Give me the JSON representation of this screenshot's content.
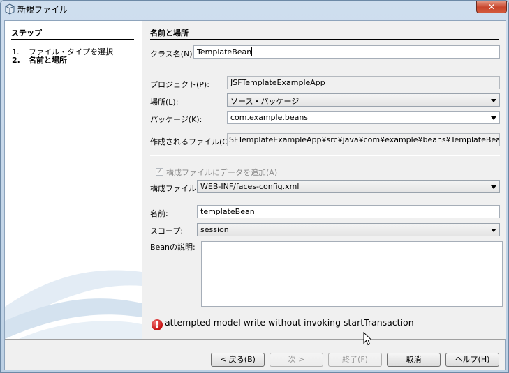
{
  "window": {
    "title": "新規ファイル",
    "close_label": "✕"
  },
  "steps": {
    "title": "ステップ",
    "items": [
      {
        "num": "1.",
        "label": "ファイル・タイプを選択"
      },
      {
        "num": "2.",
        "label": "名前と場所"
      }
    ]
  },
  "main": {
    "section_title": "名前と場所",
    "class_name": {
      "label": "クラス名(N):",
      "value": "TemplateBean"
    },
    "project": {
      "label": "プロジェクト(P):",
      "value": "JSFTemplateExampleApp"
    },
    "location": {
      "label": "場所(L):",
      "value": "ソース・パッケージ"
    },
    "package": {
      "label": "パッケージ(K):",
      "value": "com.example.beans"
    },
    "created_file": {
      "label": "作成されるファイル(C):",
      "value": "SFTemplateExampleApp¥src¥java¥com¥example¥beans¥TemplateBean.java"
    },
    "add_config": {
      "label": "構成ファイルにデータを追加(A)"
    },
    "config_file": {
      "label": "構成ファイル:",
      "value": "WEB-INF/faces-config.xml"
    },
    "bean_name": {
      "label": "名前:",
      "value": "templateBean"
    },
    "scope": {
      "label": "スコープ:",
      "value": "session"
    },
    "bean_description": {
      "label": "Beanの説明:",
      "value": ""
    },
    "error_icon": "!",
    "error_message": "attempted model write without invoking startTransaction"
  },
  "buttons": {
    "back": "< 戻る(B)",
    "next": "次 >",
    "finish": "終了(F)",
    "cancel": "取消",
    "help": "ヘルプ(H)"
  },
  "colors": {
    "error": "#c41010",
    "close_button": "#c7452c"
  }
}
